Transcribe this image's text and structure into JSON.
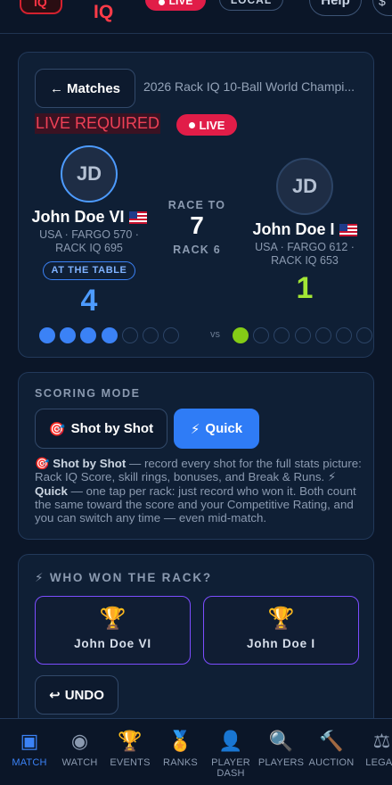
{
  "header": {
    "logo_text": "IQ",
    "brand": "IQ",
    "live_label": "LIVE",
    "local_label": "LOCAL",
    "help_label": "Help",
    "edge_label": "$"
  },
  "match": {
    "back_label": "Matches",
    "back_arrow": "←",
    "event_title": "2026 Rack IQ 10-Ball World Champi...",
    "live_required": "LIVE REQUIRED",
    "live_label": "LIVE",
    "race_to_label": "RACE TO",
    "race_to": "7",
    "rack_label": "RACK 6",
    "vs_label": "vs",
    "player1": {
      "initials": "JD",
      "name": "John Doe VI",
      "meta": "USA · FARGO 570 · RACK IQ 695",
      "badge": "AT THE TABLE",
      "score": "4",
      "racks_won": 4,
      "color": "#3b82f6"
    },
    "player2": {
      "initials": "JD",
      "name": "John Doe I",
      "meta": "USA · FARGO 612 · RACK IQ 653",
      "score": "1",
      "racks_won": 1,
      "color": "#84cc16"
    }
  },
  "scoring": {
    "label": "SCORING MODE",
    "shot_label": "Shot by Shot",
    "shot_icon": "🎯",
    "quick_label": "Quick",
    "quick_icon": "⚡",
    "selected": "Quick",
    "desc_shot_bold": "Shot by Shot",
    "desc_shot_text": " — record every shot for the full stats picture: Rack IQ Score, skill rings, bonuses, and Break & Runs. ",
    "desc_quick_bold": "Quick",
    "desc_quick_text": " — one tap per rack: just record who won it. Both count the same toward the score and your Competitive Rating, and you can switch any time — even mid-match."
  },
  "winner": {
    "label": "WHO WON THE RACK?",
    "icon": "⚡",
    "option_a": "John Doe VI",
    "option_b": "John Doe I",
    "undo_label": "UNDO",
    "undo_icon": "↩"
  },
  "nav": [
    {
      "label": "MATCH",
      "icon": "match-icon",
      "glyph": "▣",
      "active": true
    },
    {
      "label": "WATCH",
      "icon": "watch-icon",
      "glyph": "◉",
      "active": false
    },
    {
      "label": "EVENTS",
      "icon": "trophy-icon",
      "glyph": "🏆",
      "active": false
    },
    {
      "label": "RANKS",
      "icon": "medal-icon",
      "glyph": "🏅",
      "active": false
    },
    {
      "label": "PLAYER DASH",
      "icon": "person-icon",
      "glyph": "👤",
      "active": false
    },
    {
      "label": "PLAYERS",
      "icon": "search-icon",
      "glyph": "🔍",
      "active": false
    },
    {
      "label": "AUCTION",
      "icon": "gavel-icon",
      "glyph": "🔨",
      "active": false
    },
    {
      "label": "LEGAL",
      "icon": "scales-icon",
      "glyph": "⚖",
      "active": false
    }
  ],
  "colors": {
    "accent_blue": "#3b82f6",
    "accent_green": "#84cc16",
    "live_red": "#e11d48",
    "winner_border": "#7c4dff"
  }
}
